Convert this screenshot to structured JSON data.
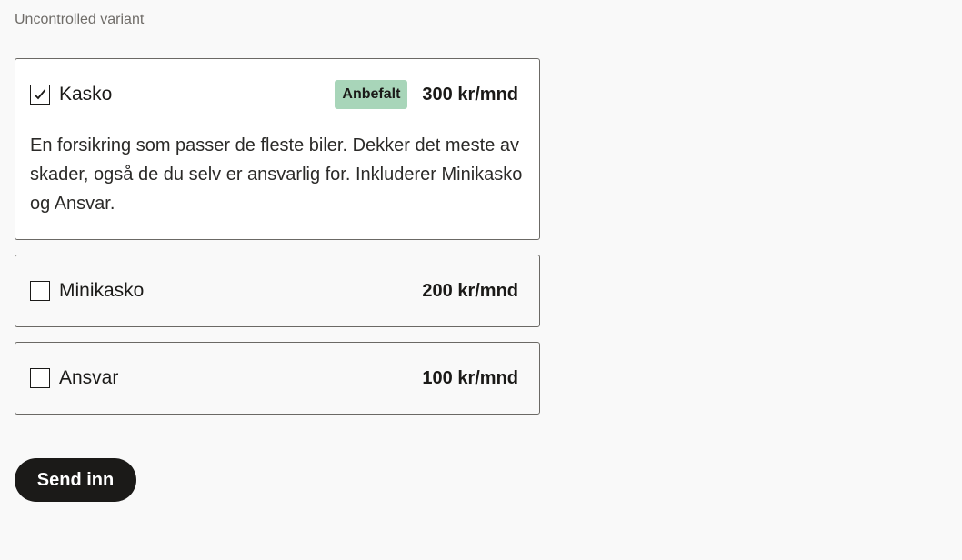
{
  "variant_label": "Uncontrolled variant",
  "options": [
    {
      "name": "Kasko",
      "checked": true,
      "badge": "Anbefalt",
      "price": "300 kr/mnd",
      "description": "En forsikring som passer de fleste biler. Dekker det meste av skader, også de du selv er ansvarlig for. Inkluderer Minikasko og Ansvar."
    },
    {
      "name": "Minikasko",
      "checked": false,
      "price": "200 kr/mnd"
    },
    {
      "name": "Ansvar",
      "checked": false,
      "price": "100 kr/mnd"
    }
  ],
  "submit_label": "Send inn",
  "colors": {
    "badge_bg": "#a8d5b9",
    "button_bg": "#1b1a18",
    "page_bg": "#f9f9f9"
  }
}
